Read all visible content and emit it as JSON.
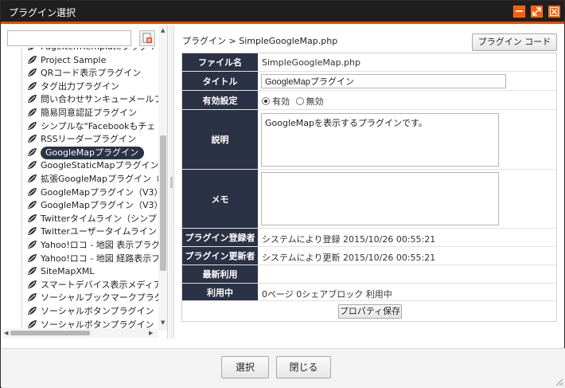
{
  "window": {
    "title": "プラグイン選択"
  },
  "search": {
    "value": "",
    "placeholder": ""
  },
  "tree": {
    "items": [
      {
        "label": "PageItemTemplateプラグイン",
        "selected": false
      },
      {
        "label": "Project Sample",
        "selected": false
      },
      {
        "label": "QRコード表示プラグイン",
        "selected": false
      },
      {
        "label": "タグ出力プラグイン",
        "selected": false
      },
      {
        "label": "問い合わせサンキューメールプ",
        "selected": false
      },
      {
        "label": "簡易同意認証プラグイン",
        "selected": false
      },
      {
        "label": "シンプルな\"Facebookもチェ",
        "selected": false
      },
      {
        "label": "RSSリーダープラグイン",
        "selected": false
      },
      {
        "label": "GoogleMapプラグイン",
        "selected": true
      },
      {
        "label": "GoogleStaticMapプラグイン",
        "selected": false
      },
      {
        "label": "拡張GoogleMapプラグイン（",
        "selected": false
      },
      {
        "label": "GoogleMapプラグイン（V3）",
        "selected": false
      },
      {
        "label": "GoogleMapプラグイン（V3）",
        "selected": false
      },
      {
        "label": "Twitterタイムライン（シンプ",
        "selected": false
      },
      {
        "label": "Twitterユーザータイムライン",
        "selected": false
      },
      {
        "label": "Yahoo!ロコ - 地図 表示プラグ",
        "selected": false
      },
      {
        "label": "Yahoo!ロコ - 地図 経路表示プ",
        "selected": false
      },
      {
        "label": "SiteMapXML",
        "selected": false
      },
      {
        "label": "スマートデバイス表示メディア",
        "selected": false
      },
      {
        "label": "ソーシャルブックマークプラグ",
        "selected": false
      },
      {
        "label": "ソーシャルボタンプラグイン",
        "selected": false
      },
      {
        "label": "ソーシャルボタンプラグイン",
        "selected": false
      }
    ]
  },
  "breadcrumb": "プラグイン > SimpleGoogleMap.php",
  "plugin_code_button": "プラグイン コード",
  "properties": {
    "filename_label": "ファイル名",
    "filename_value": "SimpleGoogleMap.php",
    "title_label": "タイトル",
    "title_value": "GoogleMapプラグイン",
    "enabled_label": "有効設定",
    "enabled_on": "有効",
    "enabled_off": "無効",
    "enabled_value": "有効",
    "description_label": "説明",
    "description_value": "GoogleMapを表示するプラグインです。",
    "memo_label": "メモ",
    "memo_value": "",
    "registrant_label": "プラグイン登録者",
    "registrant_value": "システムにより登録 2015/10/26 00:55:21",
    "updater_label": "プラグイン更新者",
    "updater_value": "システムにより更新 2015/10/26 00:55:21",
    "last_used_label": "最新利用",
    "last_used_value": "",
    "in_use_label": "利用中",
    "in_use_value": "0ページ 0シェアブロック 利用中",
    "save_button": "プロパティ保存"
  },
  "footer": {
    "select_button": "選択",
    "close_button": "閉じる"
  },
  "colors": {
    "titlebar": "#1f1f1f",
    "accent": "#ff5a00",
    "label_bg": "#2b3245"
  }
}
